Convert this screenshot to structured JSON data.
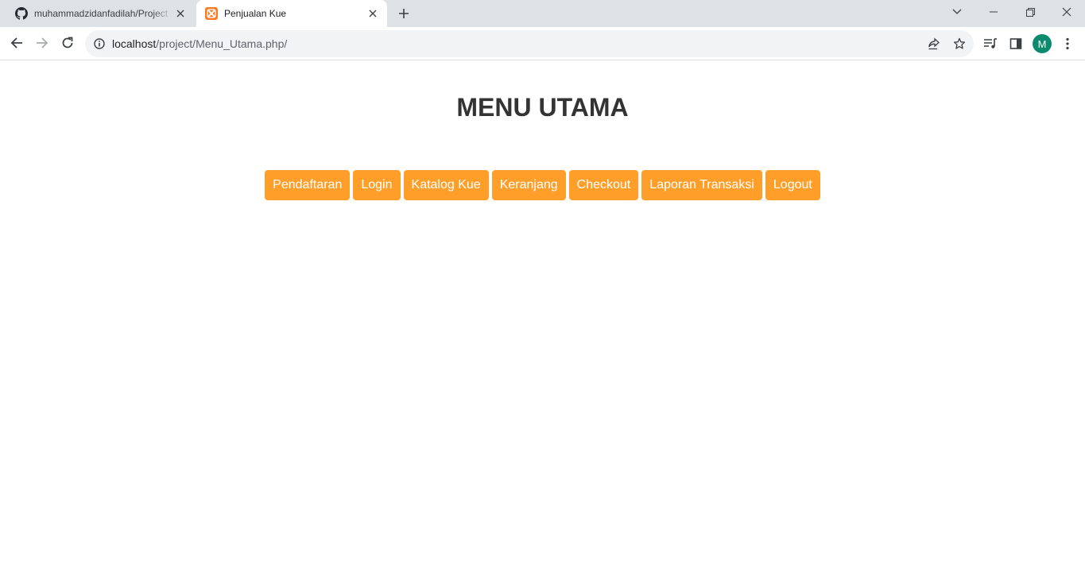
{
  "browser": {
    "tabs": [
      {
        "title": "muhammadzidanfadilah/Project",
        "favicon": "github-icon",
        "active": false
      },
      {
        "title": "Penjualan Kue",
        "favicon": "xampp-icon",
        "active": true
      }
    ],
    "address": {
      "host": "localhost",
      "path": "/project/Menu_Utama.php/"
    },
    "profile_initial": "M",
    "profile_color": "#0b8a6e"
  },
  "page": {
    "title": "MENU UTAMA",
    "menu": [
      {
        "label": "Pendaftaran"
      },
      {
        "label": "Login"
      },
      {
        "label": "Katalog Kue"
      },
      {
        "label": "Keranjang"
      },
      {
        "label": "Checkout"
      },
      {
        "label": "Laporan Transaksi"
      },
      {
        "label": "Logout"
      }
    ],
    "accent_color": "#ff9f2a"
  }
}
